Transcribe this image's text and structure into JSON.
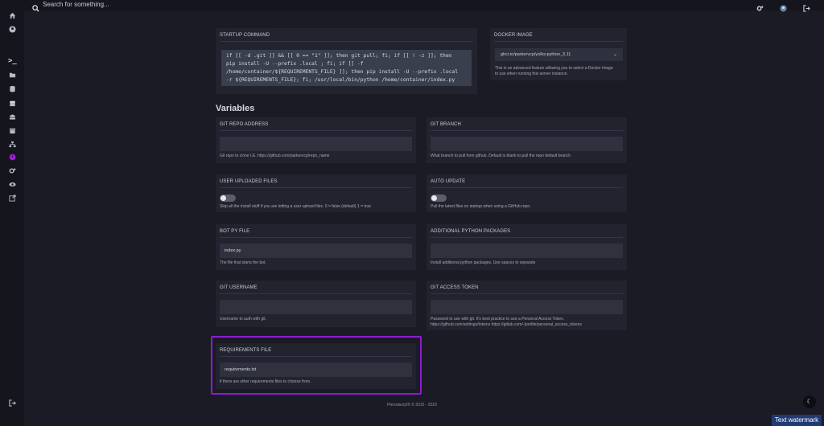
{
  "topbar": {
    "search_placeholder": "Search for something...",
    "icons": [
      "cogs-icon",
      "avatar-icon",
      "logout-icon"
    ]
  },
  "sidebar": {
    "items": [
      {
        "icon": "home-icon"
      },
      {
        "icon": "account-icon"
      },
      {
        "icon": "console-icon"
      },
      {
        "icon": "folder-icon"
      },
      {
        "icon": "database-icon"
      },
      {
        "icon": "calendar-icon"
      },
      {
        "icon": "users-icon"
      },
      {
        "icon": "archive-icon"
      },
      {
        "icon": "network-icon"
      },
      {
        "icon": "startup-icon"
      },
      {
        "icon": "settings-icon"
      },
      {
        "icon": "activity-icon"
      },
      {
        "icon": "external-link-icon"
      }
    ],
    "bottom_icon": "logout-icon"
  },
  "startup": {
    "title": "STARTUP COMMAND",
    "command_lines": [
      "if [[ -d .git ]] && [[ 0 == \"1\" ]]; then git pull; fi; if [[ ! -z ]]; then",
      "pip install -U --prefix .local ; fi; if [[ -f",
      "/home/container/${REQUIREMENTS_FILE} ]]; then pip install -U --prefix .local",
      "-r ${REQUIREMENTS_FILE}; fi; /usr/local/bin/python /home/container/index.py"
    ]
  },
  "docker": {
    "title": "DOCKER IMAGE",
    "selected": "ghcr.io/parkervcp/yolks:python_3.11",
    "help_lines": [
      "This is an advanced feature allowing you to select a Docker image",
      "to use when running this server instance."
    ]
  },
  "variables_heading": "Variables",
  "variables": {
    "git_repo": {
      "title": "GIT REPO ADDRESS",
      "value": "",
      "help": "Git repo to clone I.E. https://github.com/parkervcp/repo_name"
    },
    "git_branch": {
      "title": "GIT BRANCH",
      "value": "",
      "help": "What branch to pull from github. Default is blank to pull the repo default branch"
    },
    "user_uploaded": {
      "title": "USER UPLOADED FILES",
      "help": "Skip all the install stuff if you are letting a user upload files. 0 = false (default) 1 = true"
    },
    "auto_update": {
      "title": "AUTO UPDATE",
      "help": "Pull the latest files on startup when using a GitHub repo."
    },
    "bot_py_file": {
      "title": "BOT PY FILE",
      "value": "index.py",
      "help": "The file that starts the bot."
    },
    "additional_packages": {
      "title": "ADDITIONAL PYTHON PACKAGES",
      "value": "",
      "help": "Install additional python packages. Use spaces to separate"
    },
    "git_username": {
      "title": "GIT USERNAME",
      "value": "",
      "help": "Username to auth with git."
    },
    "git_token": {
      "title": "GIT ACCESS TOKEN",
      "value": "",
      "help_lines": [
        "Password to use with git. It's best practice to use a Personal Access Token.",
        "https://github.com/settings/tokens https://gitlab.com/-/profile/personal_access_tokens"
      ]
    },
    "requirements": {
      "title": "REQUIREMENTS FILE",
      "value": "requirements.txt",
      "help": "if there are other requirements files to choose from."
    }
  },
  "footer": "Pterodactyl® © 2015 - 2023",
  "watermark": "Text watermark",
  "colors": {
    "highlight": "#8e1bd6",
    "background": "#1a1b24",
    "panel": "#22232e"
  }
}
